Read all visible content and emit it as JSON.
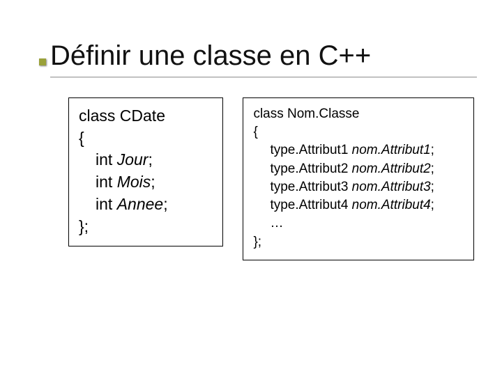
{
  "title": "Définir une classe en C++",
  "left": {
    "l1": "class CDate",
    "l2": "{",
    "l3_kw": "int ",
    "l3_nm": "Jour",
    "l3_sc": ";",
    "l4_kw": "int ",
    "l4_nm": "Mois",
    "l4_sc": ";",
    "l5_kw": "int ",
    "l5_nm": "Annee",
    "l5_sc": ";",
    "l6": "};"
  },
  "right": {
    "l1": "class Nom.Classe",
    "l2": "{",
    "a1_t": "type.Attribut1 ",
    "a1_n": "nom.Attribut1",
    "a1_s": ";",
    "a2_t": "type.Attribut2 ",
    "a2_n": "nom.Attribut2",
    "a2_s": ";",
    "a3_t": "type.Attribut3 ",
    "a3_n": "nom.Attribut3",
    "a3_s": ";",
    "a4_t": "type.Attribut4 ",
    "a4_n": "nom.Attribut4",
    "a4_s": ";",
    "ell": "…",
    "close": "};"
  }
}
